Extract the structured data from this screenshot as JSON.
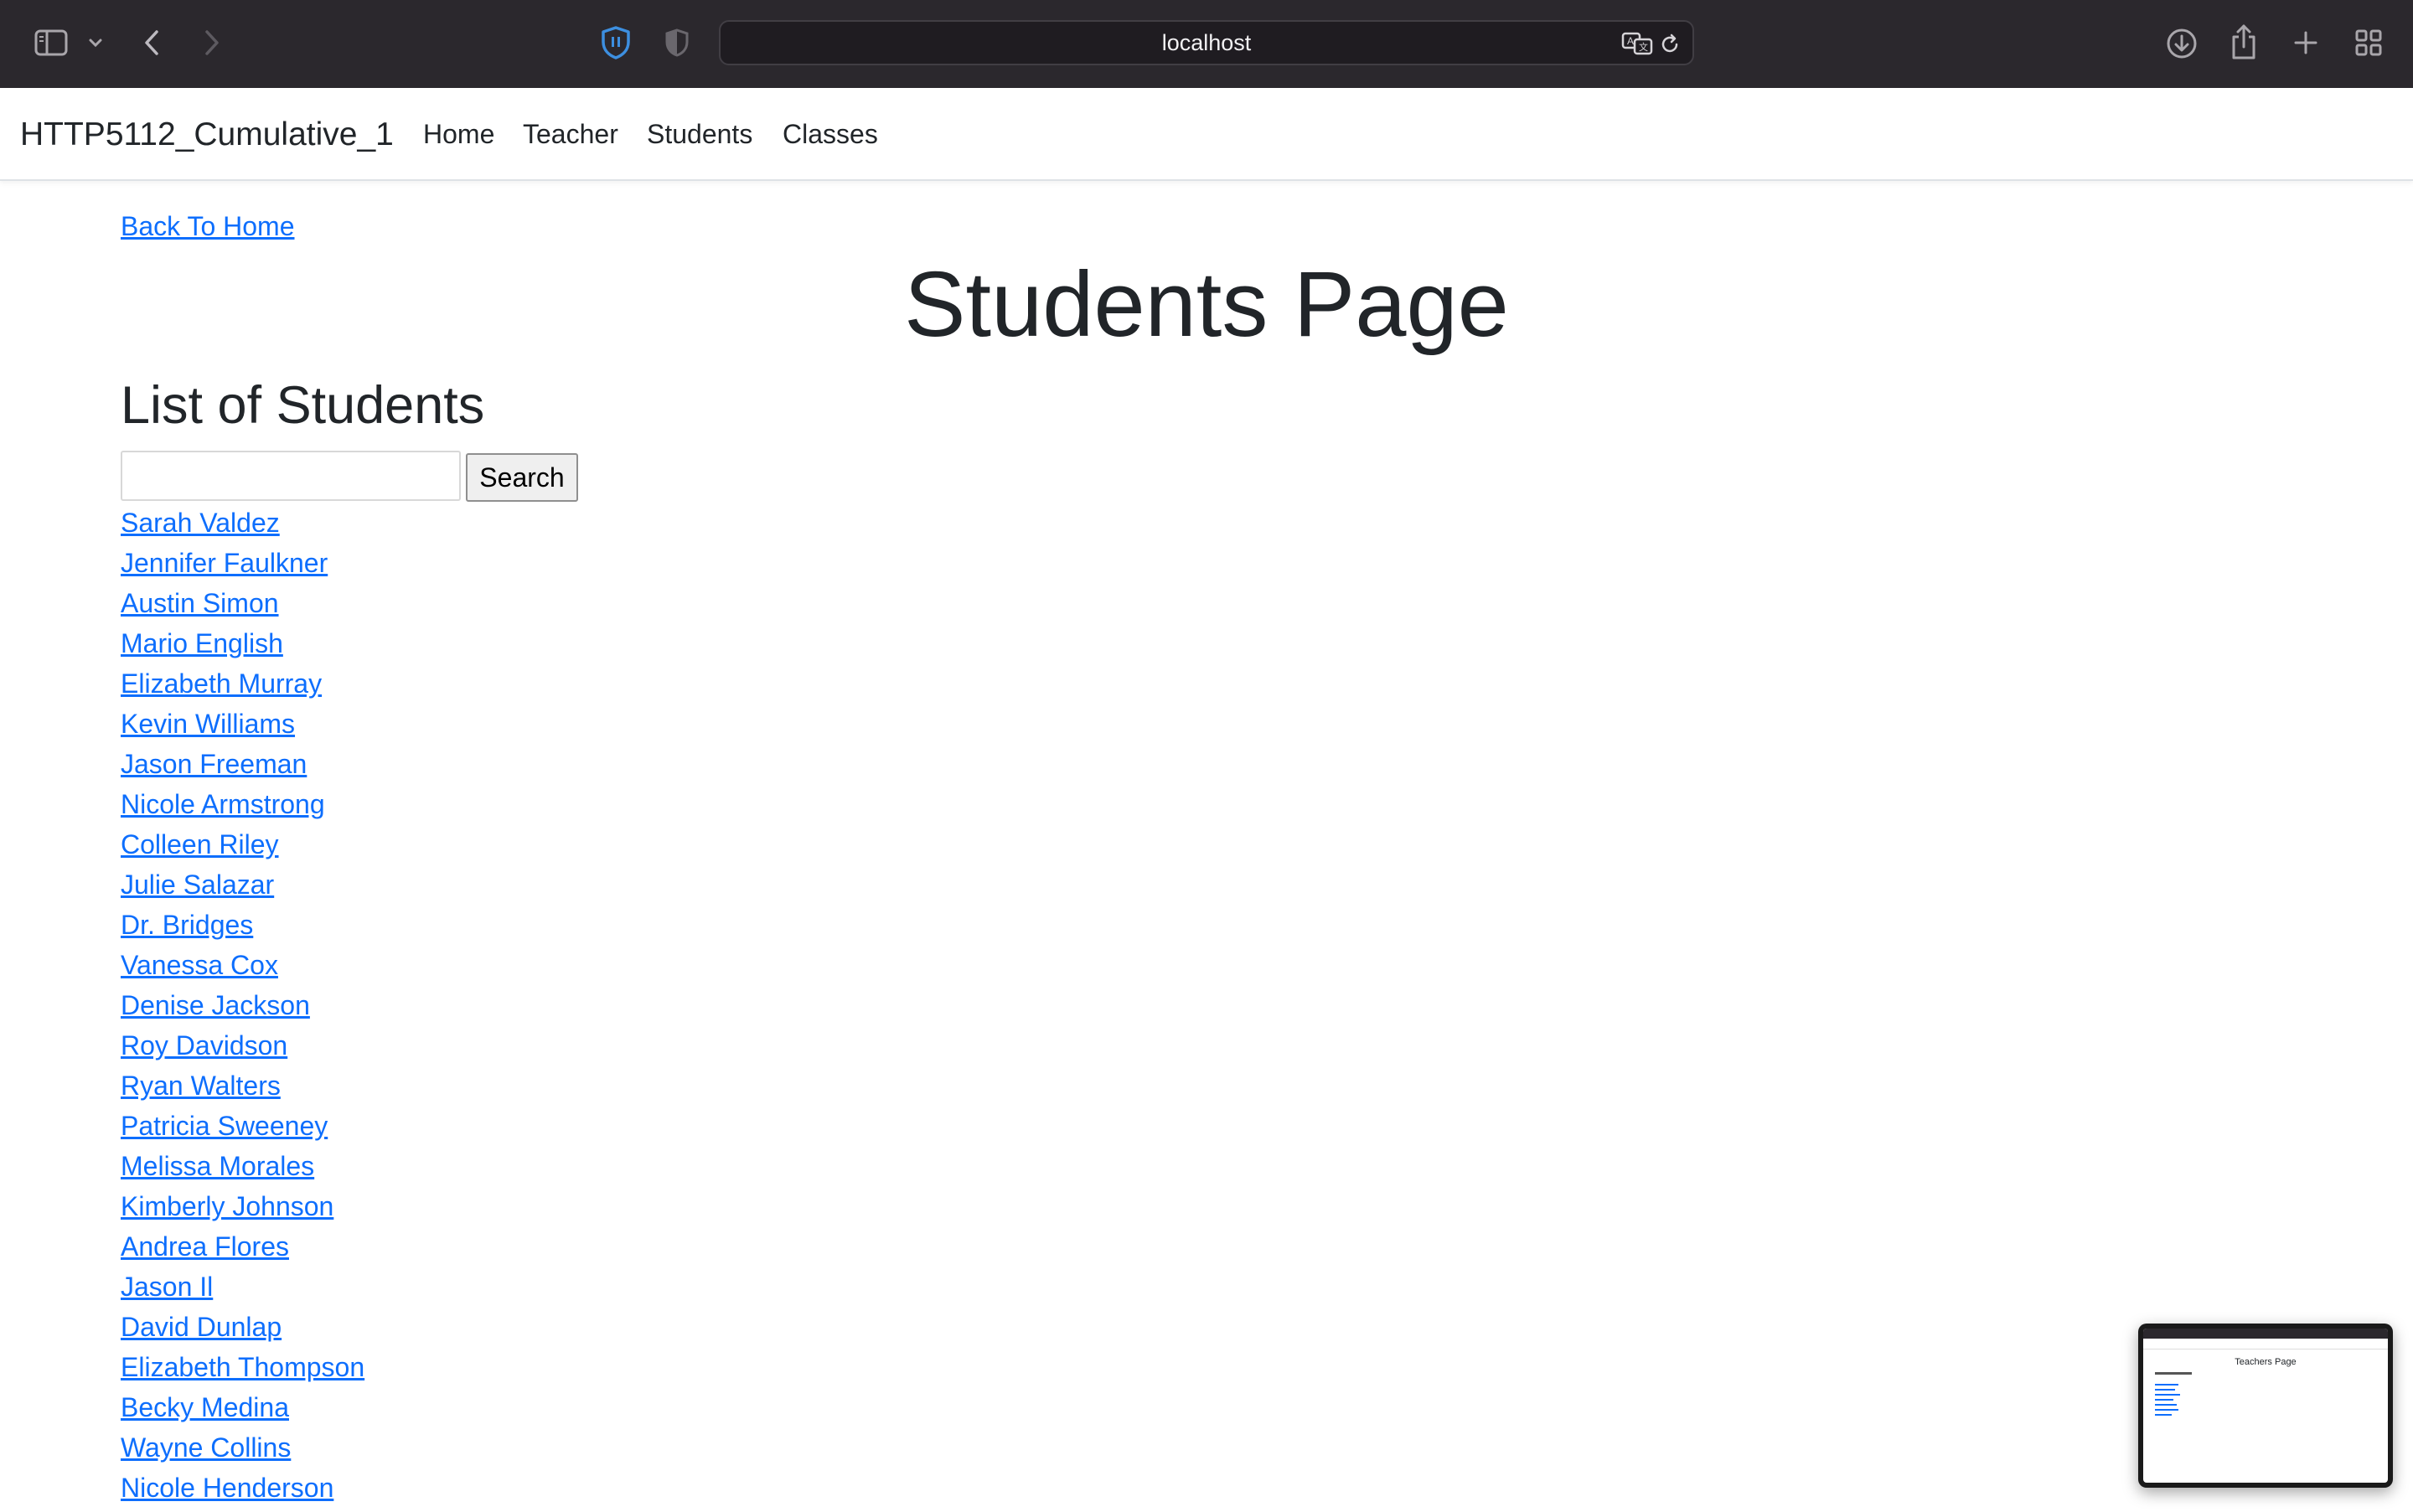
{
  "browser": {
    "url": "localhost"
  },
  "navbar": {
    "brand": "HTTP5112_Cumulative_1",
    "links": [
      "Home",
      "Teacher",
      "Students",
      "Classes"
    ]
  },
  "page": {
    "back_link": "Back To Home",
    "title": "Students Page",
    "list_heading": "List of Students",
    "search": {
      "placeholder": "",
      "value": "",
      "button_label": "Search"
    },
    "students": [
      "Sarah Valdez",
      "Jennifer Faulkner",
      "Austin Simon",
      "Mario English",
      "Elizabeth Murray",
      "Kevin Williams",
      "Jason Freeman",
      "Nicole Armstrong",
      "Colleen Riley",
      "Julie Salazar",
      "Dr. Bridges",
      "Vanessa Cox",
      "Denise Jackson",
      "Roy Davidson",
      "Ryan Walters",
      "Patricia Sweeney",
      "Melissa Morales",
      "Kimberly Johnson",
      "Andrea Flores",
      "Jason Il",
      "David Dunlap",
      "Elizabeth Thompson",
      "Becky Medina",
      "Wayne Collins",
      "Nicole Henderson"
    ]
  },
  "thumbnail": {
    "title": "Teachers Page"
  },
  "colors": {
    "chrome_bg": "#2b282d",
    "link": "#0d6efd",
    "text": "#212529"
  },
  "icons": [
    "sidebar-icon",
    "chevron-down-icon",
    "back-icon",
    "forward-icon",
    "shield-icon",
    "privacy-icon",
    "translate-icon",
    "reload-icon",
    "download-icon",
    "share-icon",
    "plus-icon",
    "tabs-grid-icon"
  ]
}
